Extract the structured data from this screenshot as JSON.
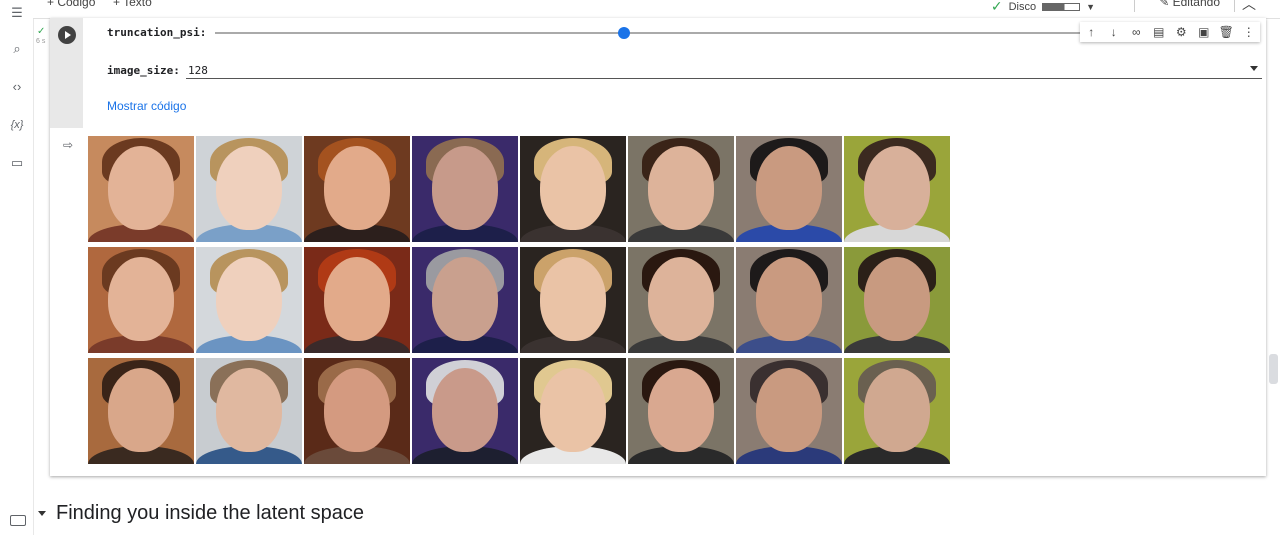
{
  "toolbar": {
    "add_code": "+ Código",
    "add_text": "+ Texto",
    "disk_label": "Disco",
    "editing_label": "Editando"
  },
  "cell": {
    "exec_time": "6 s",
    "form": {
      "truncation_label": "truncation_psi:",
      "truncation_value": 0.47,
      "image_size_label": "image_size:",
      "image_size_value": "128"
    },
    "show_code": "Mostrar código"
  },
  "cell_toolbar_icons": [
    "arrow-up-icon",
    "arrow-down-icon",
    "link-icon",
    "comment-icon",
    "settings-icon",
    "mirror-icon",
    "delete-icon",
    "more-icon"
  ],
  "output": {
    "grid_rows": 3,
    "grid_cols": 8,
    "faces": [
      {
        "bg": "#c68a5e",
        "hair": "#6b3a20",
        "skin": "#e3b397",
        "cloth": "#7a3b2a"
      },
      {
        "bg": "#cfd3d7",
        "hair": "#b8945e",
        "skin": "#efd0bd",
        "cloth": "#7aa0c8"
      },
      {
        "bg": "#6e3a20",
        "hair": "#a4521f",
        "skin": "#e2aa8a",
        "cloth": "#2c1f1c"
      },
      {
        "bg": "#3a2a6a",
        "hair": "#8a6a52",
        "skin": "#c79a8a",
        "cloth": "#1d1f4a"
      },
      {
        "bg": "#2a2420",
        "hair": "#d6b57a",
        "skin": "#eac3a6",
        "cloth": "#3a3230"
      },
      {
        "bg": "#7b7466",
        "hair": "#3a2418",
        "skin": "#ddb39a",
        "cloth": "#3a3a3a"
      },
      {
        "bg": "#8a7c72",
        "hair": "#1d1a1a",
        "skin": "#c99a80",
        "cloth": "#2b4aa8"
      },
      {
        "bg": "#9aa53a",
        "hair": "#3b2a20",
        "skin": "#d8b09a",
        "cloth": "#d7d7d7"
      },
      {
        "bg": "#b0683e",
        "hair": "#6b3a20",
        "skin": "#e3b397",
        "cloth": "#7a3b2a"
      },
      {
        "bg": "#d4d8dc",
        "hair": "#b8945e",
        "skin": "#efd0bd",
        "cloth": "#6b94c2"
      },
      {
        "bg": "#7a2a18",
        "hair": "#b03a15",
        "skin": "#e2aa8a",
        "cloth": "#3a2a2a"
      },
      {
        "bg": "#3a2a6a",
        "hair": "#9a9aa0",
        "skin": "#c9a08e",
        "cloth": "#1d1f4a"
      },
      {
        "bg": "#2a2420",
        "hair": "#cba26a",
        "skin": "#eac3a6",
        "cloth": "#3a3230"
      },
      {
        "bg": "#7b7466",
        "hair": "#2a1810",
        "skin": "#ddb39a",
        "cloth": "#3a3a3a"
      },
      {
        "bg": "#8a7c72",
        "hair": "#1d1a1a",
        "skin": "#c99a80",
        "cloth": "#3c4e8a"
      },
      {
        "bg": "#8a9a3a",
        "hair": "#2b2018",
        "skin": "#c89a80",
        "cloth": "#3a3a3a"
      },
      {
        "bg": "#a86a3e",
        "hair": "#3a2418",
        "skin": "#d9a78a",
        "cloth": "#3a2a20"
      },
      {
        "bg": "#c8ccd0",
        "hair": "#8a7058",
        "skin": "#e0b8a0",
        "cloth": "#355a8a"
      },
      {
        "bg": "#5a2a18",
        "hair": "#9a6a48",
        "skin": "#d49a80",
        "cloth": "#6a4a3a"
      },
      {
        "bg": "#3a2a6a",
        "hair": "#d0d0d6",
        "skin": "#c99a8a",
        "cloth": "#1d1f30"
      },
      {
        "bg": "#2a2420",
        "hair": "#e0c890",
        "skin": "#eac3a6",
        "cloth": "#e8e8e8"
      },
      {
        "bg": "#7b7466",
        "hair": "#2a1810",
        "skin": "#d9a890",
        "cloth": "#2a2a2a"
      },
      {
        "bg": "#8a7c72",
        "hair": "#3a3030",
        "skin": "#c99a80",
        "cloth": "#2b3a7a"
      },
      {
        "bg": "#9aa53a",
        "hair": "#6a6050",
        "skin": "#d0a890",
        "cloth": "#2a2a2a"
      }
    ]
  },
  "section": {
    "title": "Finding you inside the latent space"
  }
}
